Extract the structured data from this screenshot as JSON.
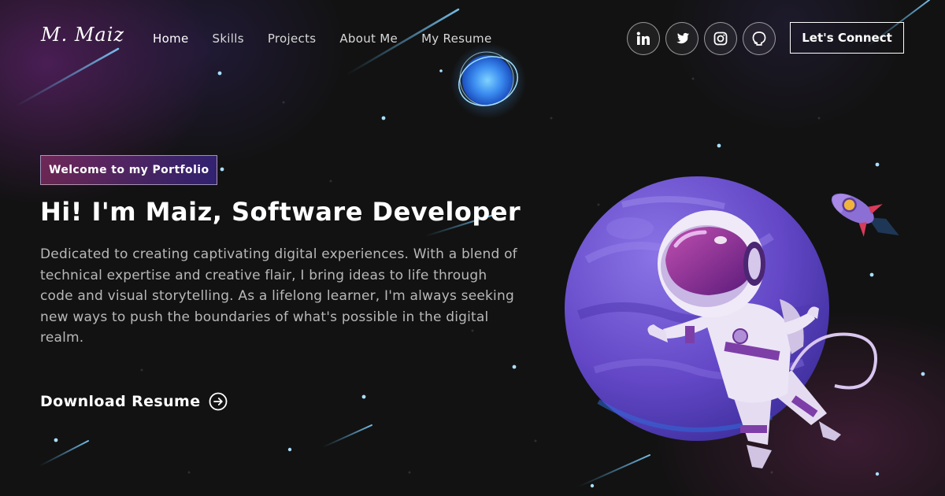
{
  "brand": {
    "logo_text": "M. Maiz"
  },
  "nav": {
    "links": [
      {
        "label": "Home"
      },
      {
        "label": "Skills"
      },
      {
        "label": "Projects"
      },
      {
        "label": "About Me"
      },
      {
        "label": "My Resume"
      }
    ],
    "social": [
      {
        "icon": "linkedin-icon"
      },
      {
        "icon": "twitter-icon"
      },
      {
        "icon": "instagram-icon"
      },
      {
        "icon": "github-icon"
      }
    ],
    "cta_label": "Let's Connect"
  },
  "hero": {
    "tagline": "Welcome to my Portfolio",
    "title": "Hi! I'm Maiz, Software Developer",
    "description": "Dedicated to creating captivating digital experiences. With a blend of technical expertise and creative flair, I bring ideas to life through code and visual storytelling. As a lifelong learner, I'm always seeking new ways to push the boundaries of what's possible in the digital realm.",
    "download_label": "Download Resume",
    "download_icon": "arrow-right-circle-icon"
  },
  "colors": {
    "background": "#121212",
    "tag_gradient_start": "#aa367c",
    "tag_gradient_end": "#4a2fbd",
    "planet": "#6a4fc8",
    "star": "#a9dfff"
  }
}
